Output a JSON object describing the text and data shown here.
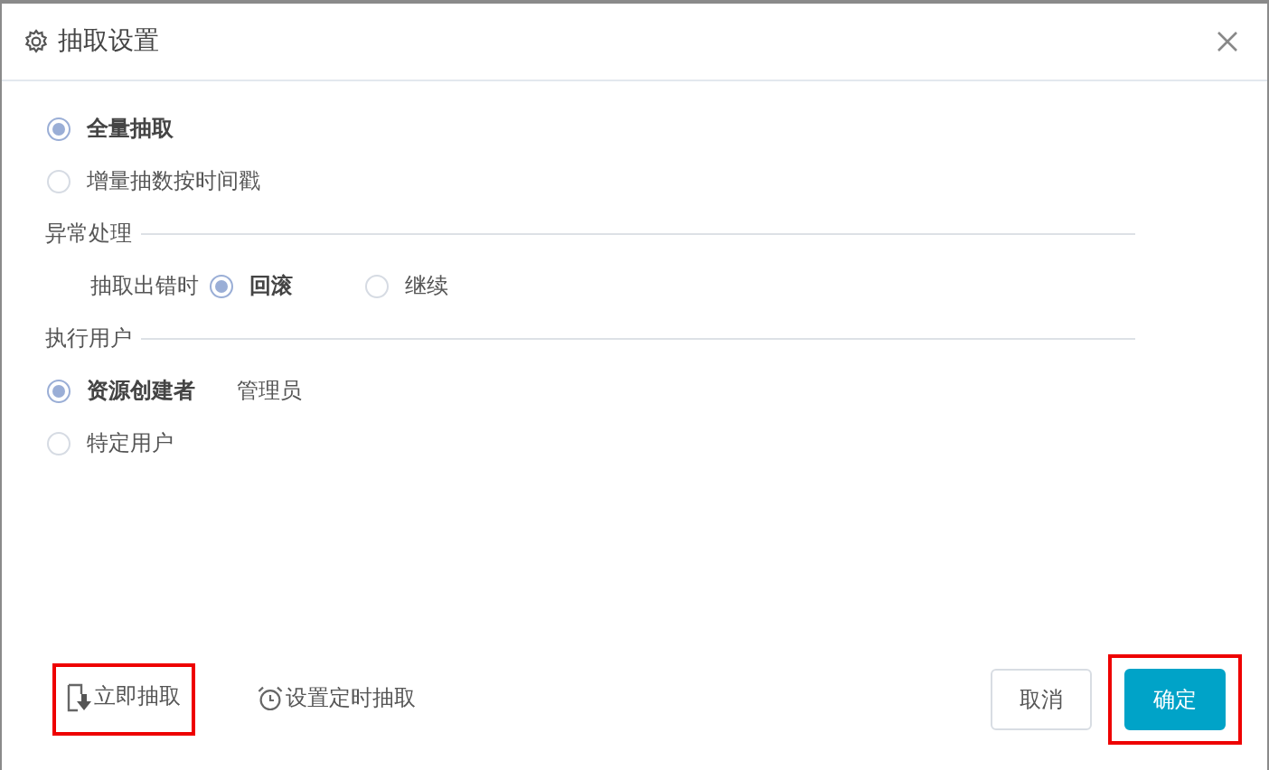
{
  "dialog": {
    "title": "抽取设置"
  },
  "extract_mode": [
    {
      "label": "全量抽取",
      "selected": true
    },
    {
      "label": "增量抽数按时间戳",
      "selected": false
    }
  ],
  "error_handling": {
    "heading": "异常处理",
    "label": "抽取出错时",
    "options": [
      {
        "label": "回滚",
        "selected": true
      },
      {
        "label": "继续",
        "selected": false
      }
    ]
  },
  "exec_user": {
    "heading": "执行用户",
    "options": [
      {
        "label": "资源创建者",
        "selected": true,
        "value": "管理员"
      },
      {
        "label": "特定用户",
        "selected": false
      }
    ]
  },
  "footer_actions": [
    {
      "kind": "extract-now",
      "label": "立即抽取",
      "highlighted": true
    },
    {
      "kind": "schedule",
      "label": "设置定时抽取",
      "highlighted": false
    }
  ],
  "buttons": [
    {
      "kind": "secondary",
      "label": "取消",
      "highlighted": false
    },
    {
      "kind": "primary",
      "label": "确定",
      "highlighted": true
    }
  ]
}
